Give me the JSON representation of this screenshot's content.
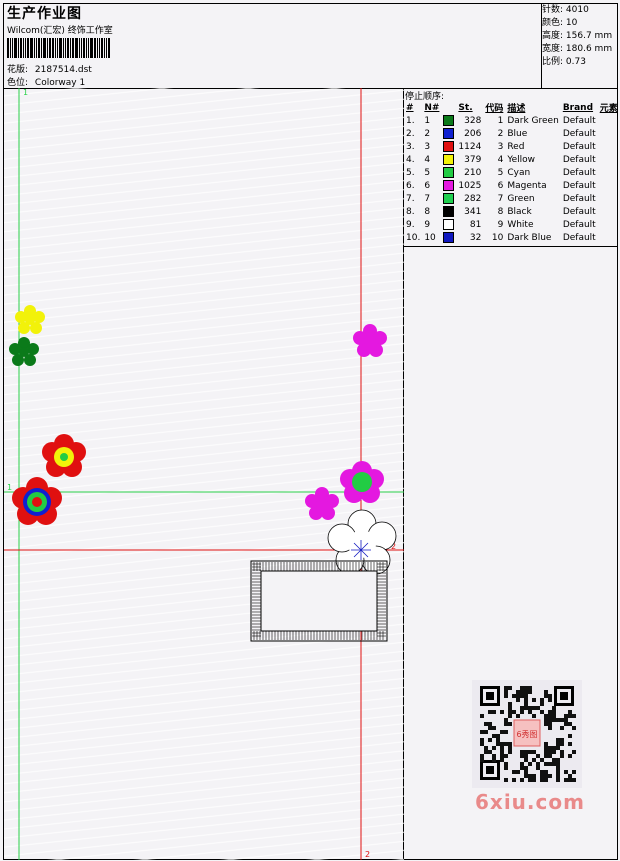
{
  "header": {
    "title": "生产作业图",
    "studio": "Wilcom(汇宏) 终饰工作室",
    "design_label": "花版:",
    "design_file": "2187514.dst",
    "colorway_label": "色位:",
    "colorway": "Colorway 1"
  },
  "stats": [
    {
      "label": "针数:",
      "value": "4010"
    },
    {
      "label": "颜色:",
      "value": "10"
    },
    {
      "label": "高度:",
      "value": "156.7 mm"
    },
    {
      "label": "宽度:",
      "value": "180.6 mm"
    },
    {
      "label": "比例:",
      "value": "0.73"
    }
  ],
  "stop_sequence": {
    "heading": "停止顺序:",
    "columns": [
      "#",
      "N#",
      "St.",
      "代码",
      "描述",
      "Brand",
      "元素"
    ],
    "rows": [
      {
        "idx": "1.",
        "n": "1",
        "st": "328",
        "code": "1",
        "desc": "Dark Green",
        "brand": "Default",
        "color": "#0b7a1a"
      },
      {
        "idx": "2.",
        "n": "2",
        "st": "206",
        "code": "2",
        "desc": "Blue",
        "brand": "Default",
        "color": "#1020d0"
      },
      {
        "idx": "3.",
        "n": "3",
        "st": "1124",
        "code": "3",
        "desc": "Red",
        "brand": "Default",
        "color": "#e01010"
      },
      {
        "idx": "4.",
        "n": "4",
        "st": "379",
        "code": "4",
        "desc": "Yellow",
        "brand": "Default",
        "color": "#f2f20a"
      },
      {
        "idx": "5.",
        "n": "5",
        "st": "210",
        "code": "5",
        "desc": "Cyan",
        "brand": "Default",
        "color": "#22cc44"
      },
      {
        "idx": "6.",
        "n": "6",
        "st": "1025",
        "code": "6",
        "desc": "Magenta",
        "brand": "Default",
        "color": "#e418e0"
      },
      {
        "idx": "7.",
        "n": "7",
        "st": "282",
        "code": "7",
        "desc": "Green",
        "brand": "Default",
        "color": "#20d050"
      },
      {
        "idx": "8.",
        "n": "8",
        "st": "341",
        "code": "8",
        "desc": "Black",
        "brand": "Default",
        "color": "#000000"
      },
      {
        "idx": "9.",
        "n": "9",
        "st": "81",
        "code": "9",
        "desc": "White",
        "brand": "Default",
        "color": "#ffffff"
      },
      {
        "idx": "10.",
        "n": "10",
        "st": "32",
        "code": "10",
        "desc": "Dark Blue",
        "brand": "Default",
        "color": "#1018c0"
      }
    ]
  },
  "markers": {
    "green_top": "1",
    "green_left": "1",
    "red_right": "2",
    "red_bottom": "2"
  },
  "watermark": "6xiu.com",
  "qr_stamp": "6秀图"
}
